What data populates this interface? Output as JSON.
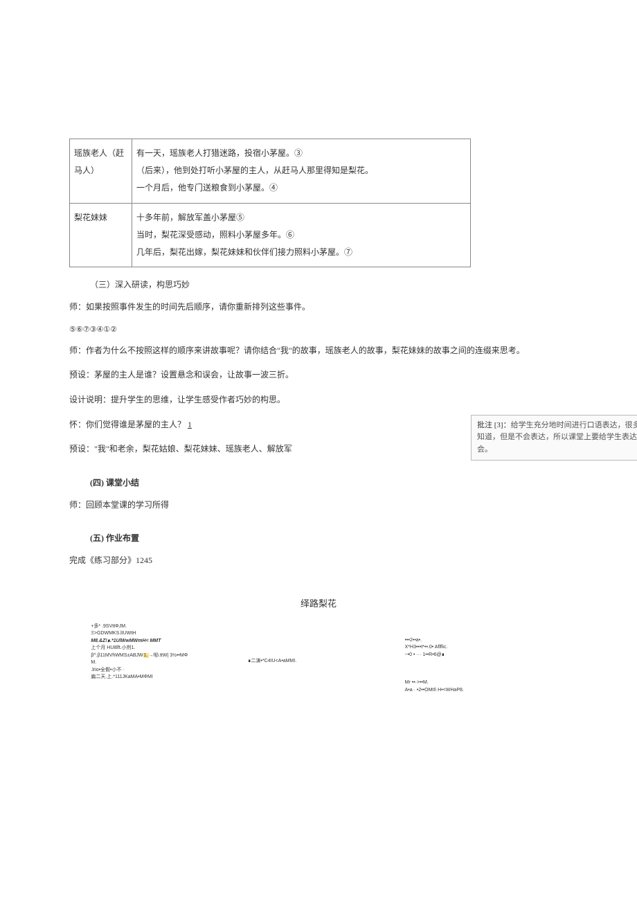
{
  "table": {
    "row1": {
      "person": "瑶族老人（赶马人）",
      "line1": "有一天，瑶族老人打猎迷路，投宿小茅屋。③",
      "line2": "（后来），他到处打听小茅屋的主人，从赶马人那里得知是梨花。",
      "line3": "一个月后，他专门送粮食到小茅屋。④"
    },
    "row2": {
      "person": "梨花妹妹",
      "line1": "十多年前，解放军盖小茅屋⑤",
      "line2": "当时，梨花深受感动，照料小茅屋多年。⑥",
      "line3": "几年后，梨花出嫁，梨花妹妹和伙伴们接力照料小茅屋。⑦"
    }
  },
  "section3_title": "（三）深入研读，构思巧妙",
  "q1": "师：如果按照事件发生的时间先后顺序，请你重新排列这些事件。",
  "numbers": "⑤⑥⑦③④①②",
  "q2": "师：作者为什么不按照这样的顺序来讲故事呢？请你结合\"我\"的故事，瑶族老人的故事，梨花妹妹的故事之间的连缀来思考。",
  "preset1": "预设：茅屋的主人是谁？设置悬念和误会，让故事一波三折。",
  "design_note": "设计说明：提升学生的思维，让学生感受作者巧妙的构思。",
  "q3_prefix": "怀：你们觉得谁是茅屋的主人？",
  "q3_num": "1",
  "preset2": "预设：\"我\"和老余，梨花姑娘、梨花妹妹、瑶族老人、解放军",
  "annotation_label": "批注 [3]：",
  "annotation_text": "给学生充分地时间进行口语表达，很多时候都知道，但是不会表达，所以课堂上要给学生表达的机会。",
  "section4_title": "(四)  课堂小结",
  "section4_text": "师：回顾本堂课的学习所得",
  "section5_title": "(五)  作业布置",
  "section5_text": "完成《练习部分》1245",
  "diagram_title": "绎路梨花",
  "diagram": {
    "c1": {
      "l1": "+多*   .9SVttΦJM.",
      "l2": "Ξ>GDWMKS.lIUWtH",
      "l3": "M8.&Z!∎.*1UlWwMWmH< MMT",
      "l4": "上个月 HU8lft.小剂1.",
      "l5_a": "β^.β11MVhWMS±ABJW",
      "l5_b": "1.",
      "l5_c": "→flβ.ttW| 3½••MΦ",
      "l6": "M.",
      "l7": "      .lrio•全假•小不 ·",
      "l8": "扁二天.上.*111JKaMA•MΦMI"
    },
    "c2": {
      "l1": "∎二演•*C4IU<A•aMMI."
    },
    "c3": {
      "l1": "                •••2••a•.",
      "l2": "X*H3•••t*••.0•      Aflflic.",
      "l3": "~•0 • ···   1••R•6@∎",
      "l4": "",
      "l5": "Mr                ••·>••M.",
      "l6": "A•a ·  •2••OMtI\\ H•<WHaP8."
    }
  }
}
